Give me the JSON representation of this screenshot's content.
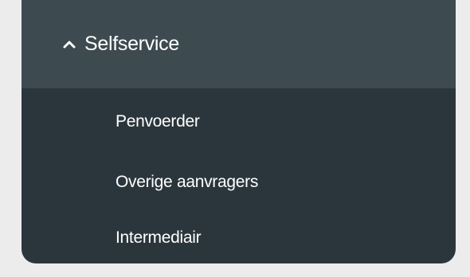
{
  "menu": {
    "section": {
      "title": "Selfservice",
      "icon": "chevron-up-icon",
      "expanded": true
    },
    "items": [
      {
        "label": "Penvoerder"
      },
      {
        "label": "Overige aanvragers"
      },
      {
        "label": "Intermediair"
      }
    ]
  },
  "colors": {
    "background": "#ececec",
    "panel": "#2b363c",
    "header": "#3d4a50",
    "text": "#ffffff"
  }
}
